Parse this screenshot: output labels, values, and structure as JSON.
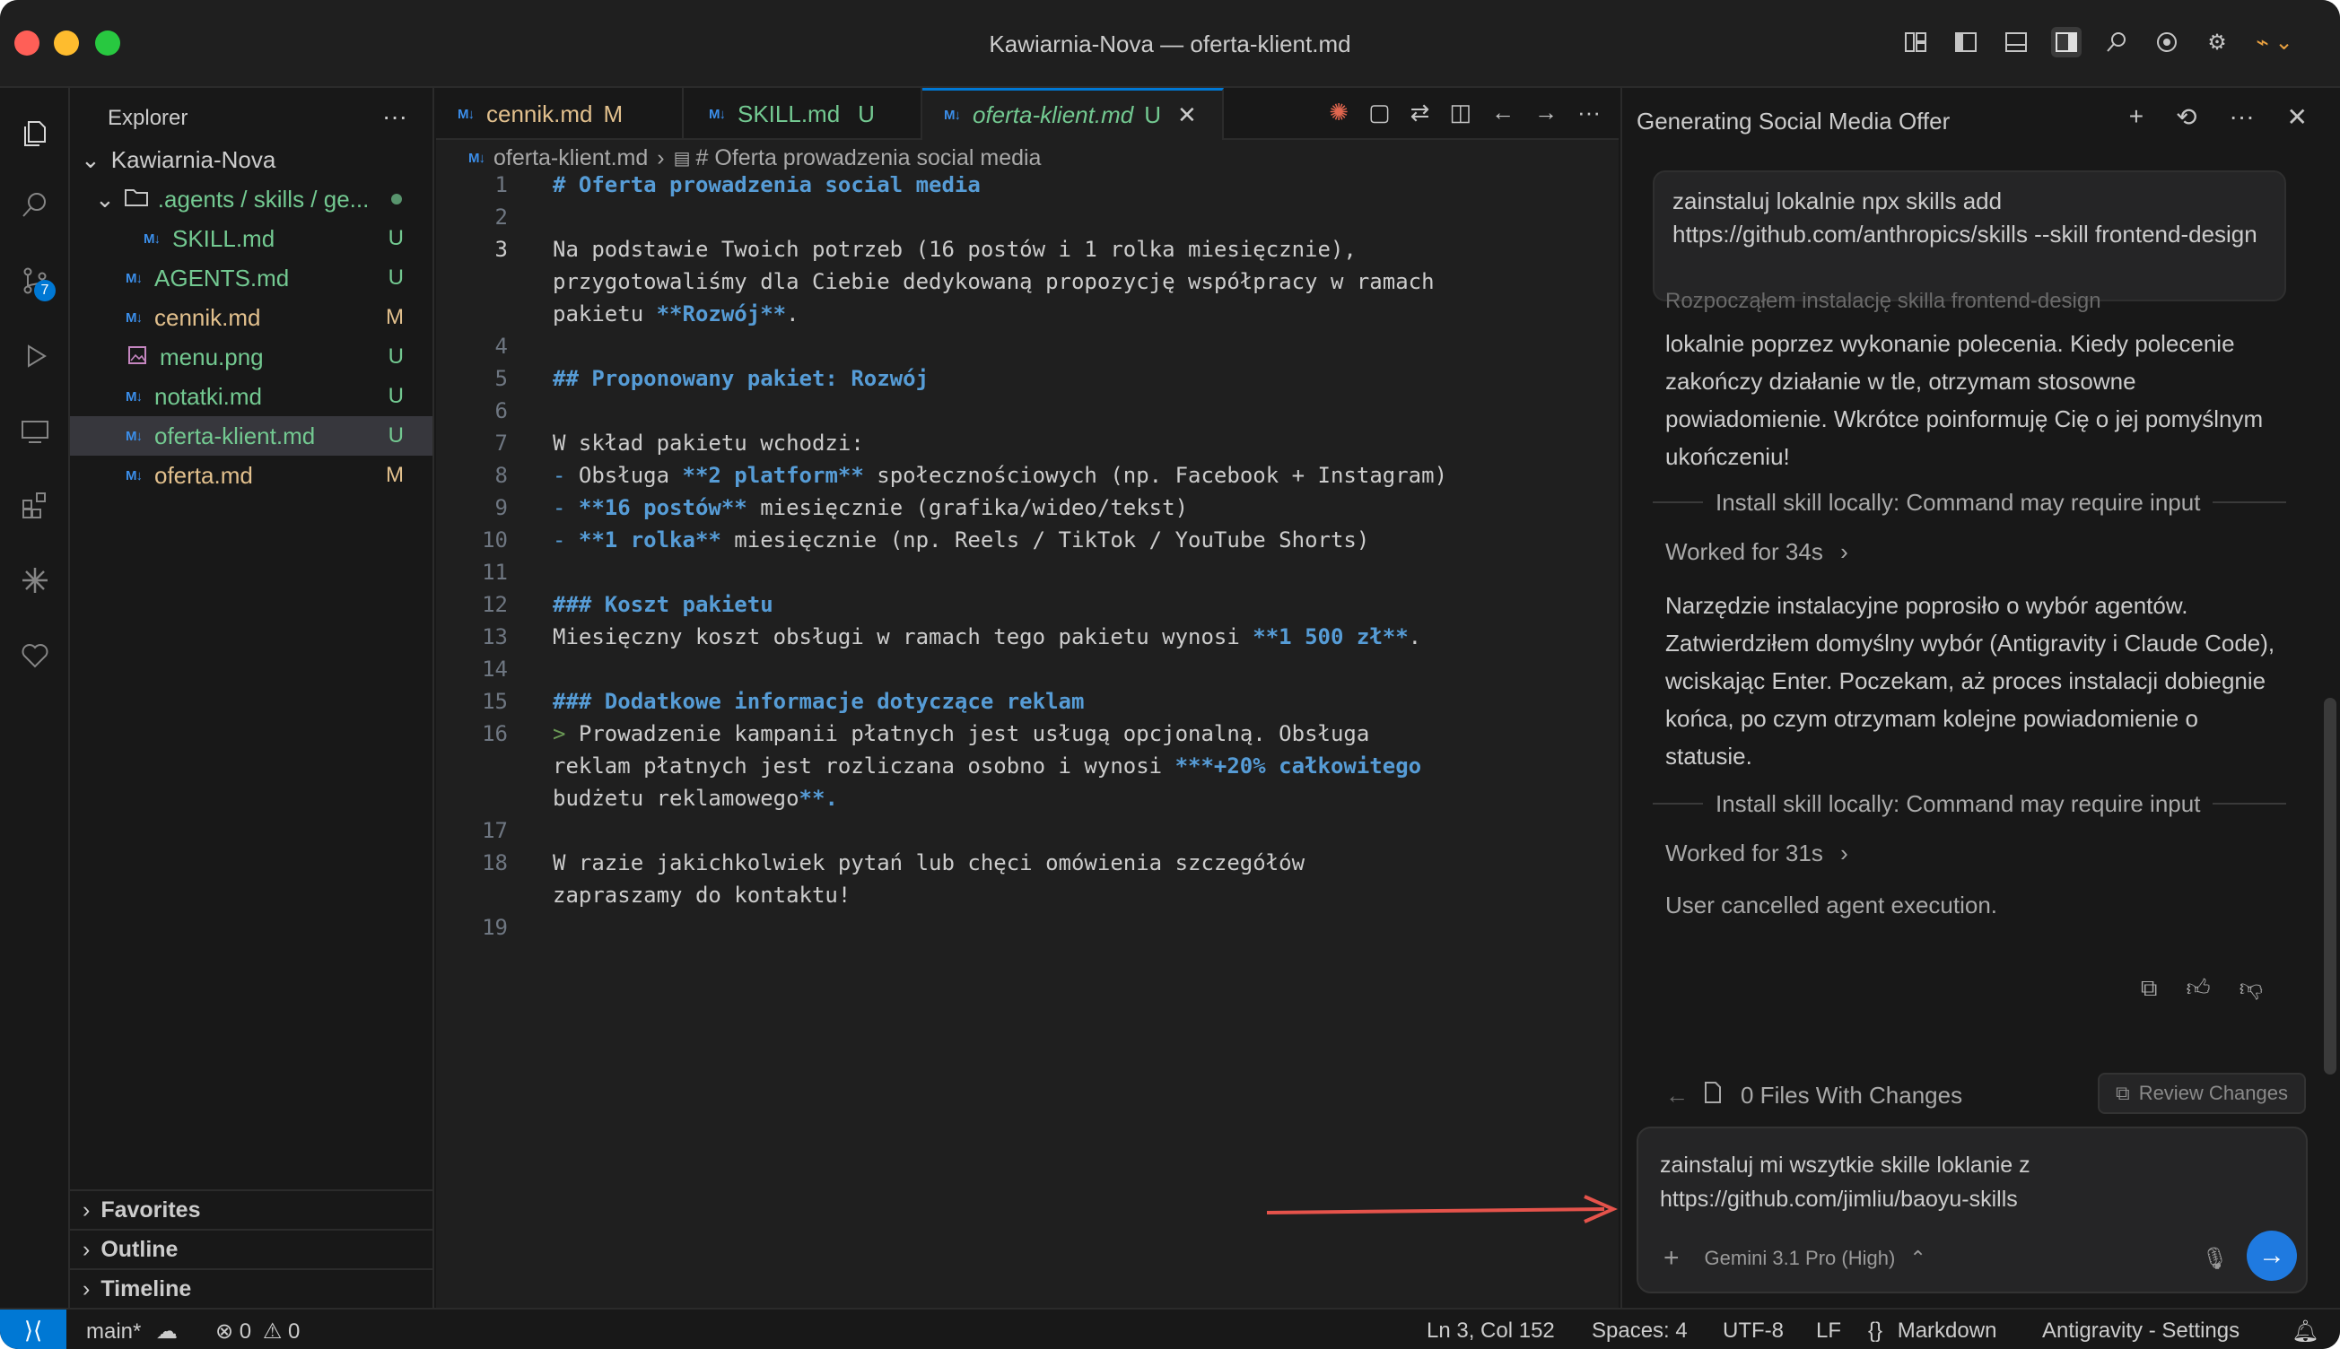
{
  "window": {
    "title": "Kawiarnia-Nova — oferta-klient.md"
  },
  "colors": {
    "accent": "#0078d4",
    "modified": "#e2c08d",
    "untracked": "#73c991",
    "heading": "#569cd6",
    "arrow": "#e5534b"
  },
  "sidebar": {
    "header": "Explorer",
    "root": "Kawiarnia-Nova",
    "folder": ".agents / skills / ge...",
    "files": [
      {
        "name": "SKILL.md",
        "status": "U",
        "type": "md"
      },
      {
        "name": "AGENTS.md",
        "status": "U",
        "type": "md"
      },
      {
        "name": "cennik.md",
        "status": "M",
        "type": "md"
      },
      {
        "name": "menu.png",
        "status": "U",
        "type": "image"
      },
      {
        "name": "notatki.md",
        "status": "U",
        "type": "md"
      },
      {
        "name": "oferta-klient.md",
        "status": "U",
        "type": "md"
      },
      {
        "name": "oferta.md",
        "status": "M",
        "type": "md"
      }
    ],
    "sections": [
      "Favorites",
      "Outline",
      "Timeline"
    ]
  },
  "tabs": [
    {
      "label": "cennik.md",
      "status": "M"
    },
    {
      "label": "SKILL.md",
      "status": "U"
    },
    {
      "label": "oferta-klient.md",
      "status": "U"
    }
  ],
  "breadcrumb": {
    "file": "oferta-klient.md",
    "symbol": "# Oferta prowadzenia social media"
  },
  "editor": {
    "lines": [
      {
        "n": "1",
        "t": "# Oferta prowadzenia social media"
      },
      {
        "n": "2",
        "t": ""
      },
      {
        "n": "3",
        "t": "Na podstawie Twoich potrzeb (16 postów i 1 rolka miesięcznie),"
      },
      {
        "n": "",
        "t": "przygotowaliśmy dla Ciebie dedykowaną propozycję współpracy w ramach"
      },
      {
        "n": "",
        "t": "pakietu **Rozwój**."
      },
      {
        "n": "4",
        "t": ""
      },
      {
        "n": "5",
        "t": "## Proponowany pakiet: Rozwój"
      },
      {
        "n": "6",
        "t": ""
      },
      {
        "n": "7",
        "t": "W skład pakietu wchodzi:"
      },
      {
        "n": "8",
        "t": "- Obsługa **2 platform** społecznościowych (np. Facebook + Instagram)"
      },
      {
        "n": "9",
        "t": "- **16 postów** miesięcznie (grafika/wideo/tekst)"
      },
      {
        "n": "10",
        "t": "- **1 rolka** miesięcznie (np. Reels / TikTok / YouTube Shorts)"
      },
      {
        "n": "11",
        "t": ""
      },
      {
        "n": "12",
        "t": "### Koszt pakietu"
      },
      {
        "n": "13",
        "t": "Miesięczny koszt obsługi w ramach tego pakietu wynosi **1 500 zł**."
      },
      {
        "n": "14",
        "t": ""
      },
      {
        "n": "15",
        "t": "### Dodatkowe informacje dotyczące reklam"
      },
      {
        "n": "16",
        "t": "> Prowadzenie kampanii płatnych jest usługą opcjonalną. Obsługa"
      },
      {
        "n": "",
        "t": "reklam płatnych jest rozliczana osobno i wynosi ***+20% całkowitego"
      },
      {
        "n": "",
        "t": "budżetu reklamowego**."
      },
      {
        "n": "17",
        "t": ""
      },
      {
        "n": "18",
        "t": "W razie jakichkolwiek pytań lub chęci omówienia szczegółów"
      },
      {
        "n": "",
        "t": "zapraszamy do kontaktu!"
      },
      {
        "n": "19",
        "t": ""
      }
    ]
  },
  "chat": {
    "title": "Generating Social Media Offer",
    "user_message": "zainstaluj lokalnie npx skills add https://github.com/anthropics/skills --skill frontend-design",
    "partial_top": "Rozpocząłem instalację skilla  frontend-design",
    "message1": "lokalnie poprzez wykonanie polecenia. Kiedy polecenie zakończy działanie w tle, otrzymam stosowne powiadomienie. Wkrótce poinformuję Cię o jej pomyślnym ukończeniu!",
    "step1": "Install skill locally: Command may require input",
    "worked1": "Worked for 34s",
    "message2": "Narzędzie instalacyjne poprosiło o wybór agentów. Zatwierdziłem domyślny wybór (Antigravity i Claude Code), wciskając Enter. Poczekam, aż proces instalacji dobiegnie końca, po czym otrzymam kolejne powiadomienie o statusie.",
    "step2": "Install skill locally: Command may require input",
    "worked2": "Worked for 31s",
    "cancelled": "User cancelled agent execution.",
    "files_changes": "0 Files With Changes",
    "review_button": "Review Changes",
    "input_text": "zainstaluj mi wszytkie skille loklanie z https://github.com/jimliu/baoyu-skills",
    "model": "Gemini 3.1 Pro (High)"
  },
  "statusbar": {
    "branch": "main*",
    "errors": "0",
    "warnings": "0",
    "position": "Ln 3, Col 152",
    "spaces": "Spaces: 4",
    "encoding": "UTF-8",
    "eol": "LF",
    "language": "Markdown",
    "settings": "Antigravity - Settings"
  }
}
